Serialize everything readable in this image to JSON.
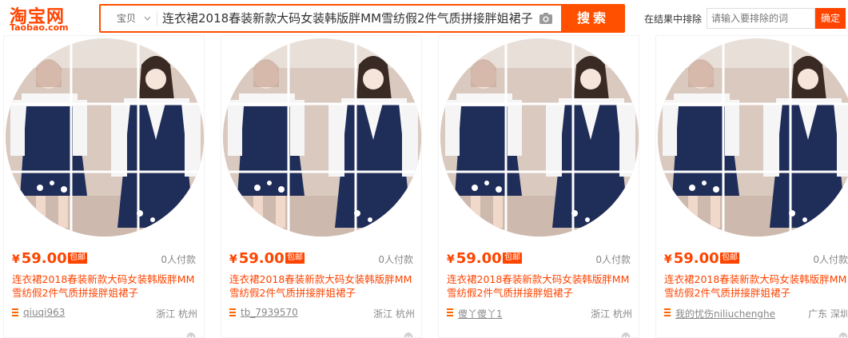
{
  "header": {
    "logo_cn": "淘宝网",
    "logo_en": "Taobao.com",
    "search_type": "宝贝",
    "search_query": "连衣裙2018春装新款大码女装韩版胖MM雪纺假2件气质拼接胖姐裙子",
    "search_button": "搜索",
    "exclude_label": "在结果中排除",
    "exclude_placeholder": "请输入要排除的词",
    "exclude_button": "确定"
  },
  "products": [
    {
      "currency": "¥",
      "price": "59.00",
      "badge": "包邮",
      "deals": "0人付款",
      "title": "连衣裙2018春装新款大码女装韩版胖MM雪纺假2件气质拼接胖姐裙子",
      "shop": "qiuqi963",
      "location": "浙江 杭州"
    },
    {
      "currency": "¥",
      "price": "59.00",
      "badge": "包邮",
      "deals": "0人付款",
      "title": "连衣裙2018春装新款大码女装韩版胖MM雪纺假2件气质拼接胖姐裙子",
      "shop": "tb_7939570",
      "location": "浙江 杭州"
    },
    {
      "currency": "¥",
      "price": "59.00",
      "badge": "包邮",
      "deals": "0人付款",
      "title": "连衣裙2018春装新款大码女装韩版胖MM雪纺假2件气质拼接胖姐裙子",
      "shop": "傻丫傻丫1",
      "location": "浙江 杭州"
    },
    {
      "currency": "¥",
      "price": "59.00",
      "badge": "包邮",
      "deals": "0人付款",
      "title": "连衣裙2018春装新款大码女装韩版胖MM雪纺假2件气质拼接胖姐裙子",
      "shop": "我的忧伤niliuchenghe",
      "location": "广东 深圳"
    }
  ],
  "colors": {
    "brand": "#ff4400",
    "search_border": "#ff5000",
    "text_gray": "#888888"
  },
  "icons": [
    "camera-icon",
    "chevron-down-icon",
    "shop-icon",
    "wangwang-icon"
  ]
}
